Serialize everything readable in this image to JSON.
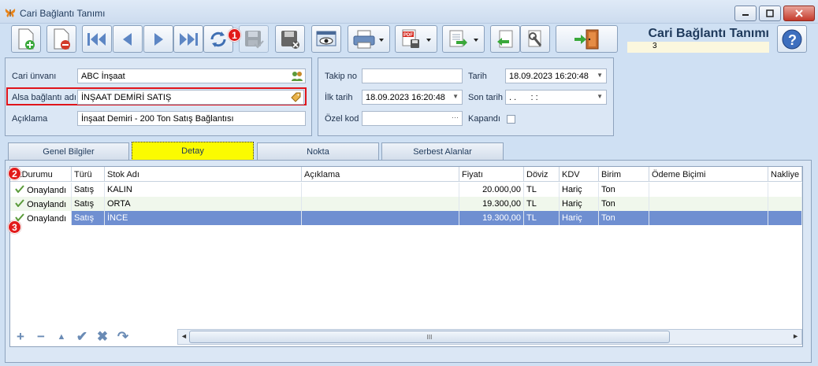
{
  "window": {
    "title": "Cari Bağlantı Tanımı",
    "icon": "butterfly-icon"
  },
  "header": {
    "title": "Cari Bağlantı Tanımı",
    "record_no": "3"
  },
  "toolbar": {
    "icons": [
      "new-document-icon",
      "delete-document-icon",
      "first-record-icon",
      "previous-record-icon",
      "next-record-icon",
      "last-record-icon",
      "refresh-icon",
      "save-icon",
      "cancel-save-icon",
      "preview-icon",
      "print-icon",
      "pdf-export-icon",
      "export-icon",
      "import-icon",
      "tools-icon",
      "exit-icon",
      "help-icon"
    ],
    "pdf_label": "PDF"
  },
  "form": {
    "cari_unvani_label": "Cari ünvanı",
    "cari_unvani_value": "ABC İnşaat",
    "alsa_label": "Alsa bağlantı adı",
    "alsa_value": "İNŞAAT DEMİRİ SATIŞ",
    "aciklama_label": "Açıklama",
    "aciklama_value": "İnşaat Demiri - 200 Ton Satış Bağlantısı",
    "takip_no_label": "Takip no",
    "takip_no_value": "",
    "tarih_label": "Tarih",
    "tarih_value": "18.09.2023 16:20:48",
    "ilk_tarih_label": "İlk tarih",
    "ilk_tarih_value": "18.09.2023 16:20:48",
    "son_tarih_label": "Son tarih",
    "son_tarih_value": ". .      : :",
    "ozel_kod_label": "Özel kod",
    "ozel_kod_value": "",
    "ozel_kod_button": "···",
    "kapandi_label": "Kapandı",
    "kapandi_checked": false
  },
  "tabs": [
    {
      "label": "Genel Bilgiler",
      "active": false
    },
    {
      "label": "Detay",
      "active": true
    },
    {
      "label": "Nokta",
      "active": false
    },
    {
      "label": "Serbest Alanlar",
      "active": false
    }
  ],
  "grid": {
    "columns": [
      "ıytDurumu",
      "Türü",
      "Stok Adı",
      "Açıklama",
      "Fiyatı",
      "Döviz",
      "KDV",
      "Birim",
      "Ödeme Biçimi",
      "Nakliye T"
    ],
    "rows": [
      {
        "durum": "Onaylandı",
        "turu": "Satış",
        "stok": "KALIN",
        "aciklama": "",
        "fiyat": "20.000,00",
        "doviz": "TL",
        "kdv": "Hariç",
        "birim": "Ton",
        "odeme": "",
        "nakliye": ""
      },
      {
        "durum": "Onaylandı",
        "turu": "Satış",
        "stok": "ORTA",
        "aciklama": "",
        "fiyat": "19.300,00",
        "doviz": "TL",
        "kdv": "Hariç",
        "birim": "Ton",
        "odeme": "",
        "nakliye": ""
      },
      {
        "durum": "Onaylandı",
        "turu": "Satış",
        "stok": "İNCE",
        "aciklama": "",
        "fiyat": "19.300,00",
        "doviz": "TL",
        "kdv": "Hariç",
        "birim": "Ton",
        "odeme": "",
        "nakliye": ""
      }
    ],
    "selected_row": 2,
    "scroll_label": "III"
  },
  "navigator": {
    "icons": [
      "add-icon",
      "remove-icon",
      "up-icon",
      "confirm-icon",
      "cancel-icon",
      "refresh-icon"
    ]
  },
  "badges": [
    "1",
    "2",
    "3"
  ],
  "colors": {
    "accent": "#6f8fd1",
    "highlight": "#fbfb00",
    "badge": "#e21a1a",
    "title": "#1e395b"
  }
}
